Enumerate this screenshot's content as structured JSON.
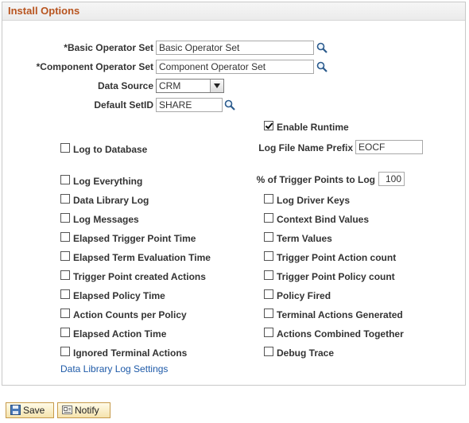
{
  "panel": {
    "title": "Install Options"
  },
  "fields": {
    "basic_operator_set": {
      "label": "*Basic Operator Set",
      "value": "Basic Operator Set"
    },
    "component_operator_set": {
      "label": "*Component Operator Set",
      "value": "Component Operator Set"
    },
    "data_source": {
      "label": "Data Source",
      "value": "CRM"
    },
    "default_setid": {
      "label": "Default SetID",
      "value": "SHARE"
    },
    "log_file_name_prefix": {
      "label": "Log File Name Prefix",
      "value": "EOCF"
    },
    "trigger_points_to_log": {
      "label": "% of Trigger Points to Log",
      "value": "100"
    }
  },
  "checkboxes": {
    "enable_runtime": {
      "label": "Enable Runtime",
      "checked": true
    },
    "log_to_database": {
      "label": "Log to Database",
      "checked": false
    },
    "log_everything": {
      "label": "Log Everything",
      "checked": false
    },
    "data_library_log": {
      "label": "Data Library Log",
      "checked": false
    },
    "log_messages": {
      "label": "Log Messages",
      "checked": false
    },
    "elapsed_trigger_point_time": {
      "label": "Elapsed Trigger Point Time",
      "checked": false
    },
    "elapsed_term_evaluation_time": {
      "label": "Elapsed Term Evaluation Time",
      "checked": false
    },
    "trigger_point_created_actions": {
      "label": "Trigger Point created Actions",
      "checked": false
    },
    "elapsed_policy_time": {
      "label": "Elapsed Policy Time",
      "checked": false
    },
    "action_counts_per_policy": {
      "label": "Action Counts per Policy",
      "checked": false
    },
    "elapsed_action_time": {
      "label": "Elapsed Action Time",
      "checked": false
    },
    "ignored_terminal_actions": {
      "label": "Ignored Terminal Actions",
      "checked": false
    },
    "log_driver_keys": {
      "label": "Log Driver Keys",
      "checked": false
    },
    "context_bind_values": {
      "label": "Context Bind Values",
      "checked": false
    },
    "term_values": {
      "label": "Term Values",
      "checked": false
    },
    "trigger_point_action_count": {
      "label": "Trigger Point Action count",
      "checked": false
    },
    "trigger_point_policy_count": {
      "label": "Trigger Point Policy count",
      "checked": false
    },
    "policy_fired": {
      "label": "Policy Fired",
      "checked": false
    },
    "terminal_actions_generated": {
      "label": "Terminal Actions Generated",
      "checked": false
    },
    "actions_combined_together": {
      "label": "Actions Combined Together",
      "checked": false
    },
    "debug_trace": {
      "label": "Debug Trace",
      "checked": false
    }
  },
  "links": {
    "data_library_log_settings": "Data Library Log Settings"
  },
  "buttons": {
    "save": "Save",
    "notify": "Notify"
  },
  "colors": {
    "title": "#b8541f",
    "link": "#1e5aa8",
    "button_border": "#c69a4a"
  },
  "icons": {
    "lookup": "magnifier-icon",
    "save": "floppy-disk-icon",
    "notify": "notify-icon"
  }
}
